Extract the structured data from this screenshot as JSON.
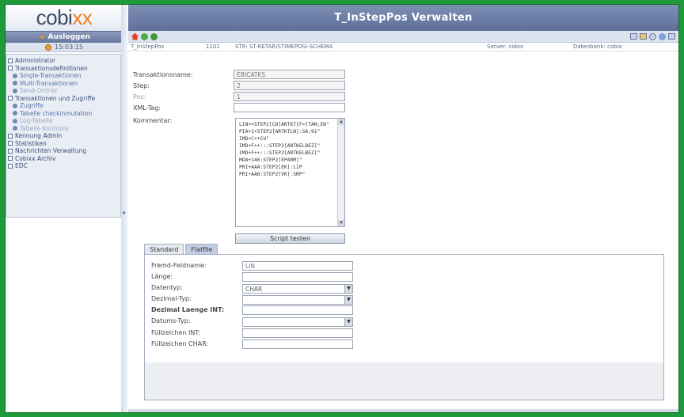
{
  "app": {
    "logo_prefix": "cobi",
    "logo_suffix": "xx",
    "logout_label": "Ausloggen",
    "time": "15:03:15",
    "window_title": "T_InStepPos Verwalten"
  },
  "sidebar": {
    "items": [
      {
        "label": "Administrator",
        "level": 0
      },
      {
        "label": "Transaktionsdefinitionen",
        "level": 0
      },
      {
        "label": "Single-Transaktionen",
        "level": 1
      },
      {
        "label": "Multi-Transaktionen",
        "level": 1
      },
      {
        "label": "Send-Ordner",
        "level": 1
      },
      {
        "label": "Transaktionen und Zugriffe",
        "level": 0
      },
      {
        "label": "Zugriffe",
        "level": 1
      },
      {
        "label": "Tabelle checkinmutation",
        "level": 1
      },
      {
        "label": "Log-Tabelle",
        "level": 1
      },
      {
        "label": "Tabelle Kontrolle",
        "level": 1
      },
      {
        "label": "Kennung Admin",
        "level": 0
      },
      {
        "label": "Statistiken",
        "level": 0
      },
      {
        "label": "Nachrichten Verwaltung",
        "level": 0
      },
      {
        "label": "Cobixx Archiv",
        "level": 0
      },
      {
        "label": "EDC",
        "level": 0
      }
    ]
  },
  "toolbar": {
    "icons_left": [
      "home-icon",
      "refresh-icon",
      "add-icon"
    ],
    "icons_right": [
      "print-icon",
      "edit-icon",
      "search-icon",
      "help-icon",
      "close-icon"
    ]
  },
  "infobar": {
    "table": "T_InStepPos",
    "id": "1101",
    "path": "STR: ST-RETAR/STIMEPOSI-SCHEMA",
    "server": "Server: cobix",
    "database": "Datenbank: cobix"
  },
  "form": {
    "transaction_label": "Transaktionsname:",
    "transaction_value": "EBICATKS",
    "step_label": "Step:",
    "step_value": "2",
    "pos_label": "Pos:",
    "pos_value": "1",
    "xml_label": "XML-Tag:",
    "xml_value": "",
    "script_label": "Kommentar:",
    "script_lines": [
      "LIN+=STEP2[CD]ARTKT[F=]TAN;EN\"",
      "PIA+1+STEP2[ARTKTLN]:SA:91\"",
      "IMD+C++CU\"",
      "IMD+F++:::STEP2[ARTKELBEZ]\"",
      "IMD+F++:::STEP2[ARTKELBEZ]\"",
      "MOA+146:STEP2[EPARM]\"",
      "PRI+AAA:STEP2[EK]:LIP",
      "PRI+AAB:STEP2[VK]:SRP\""
    ],
    "script_button": "Script testen"
  },
  "tabs": [
    {
      "label": "Standard",
      "active": false
    },
    {
      "label": "Flatfile",
      "active": true
    }
  ],
  "flatfile": {
    "field_name_label": "Fremd-Feldname:",
    "field_name_value": "LIN",
    "length_label": "Länge:",
    "length_value": "",
    "datatype_label": "Datentyp:",
    "datatype_value": "CHAR",
    "decimal_type_label": "Dezimal-Typ:",
    "decimal_type_value": "",
    "decimal_length_label": "Dezimal Laenge INT:",
    "decimal_length_value": "",
    "date_type_label": "Datums-Typ:",
    "date_type_value": "",
    "fill_int_label": "Füllzeichen INT:",
    "fill_int_value": "",
    "fill_char_label": "Füllzeichen CHAR:",
    "fill_char_value": ""
  }
}
